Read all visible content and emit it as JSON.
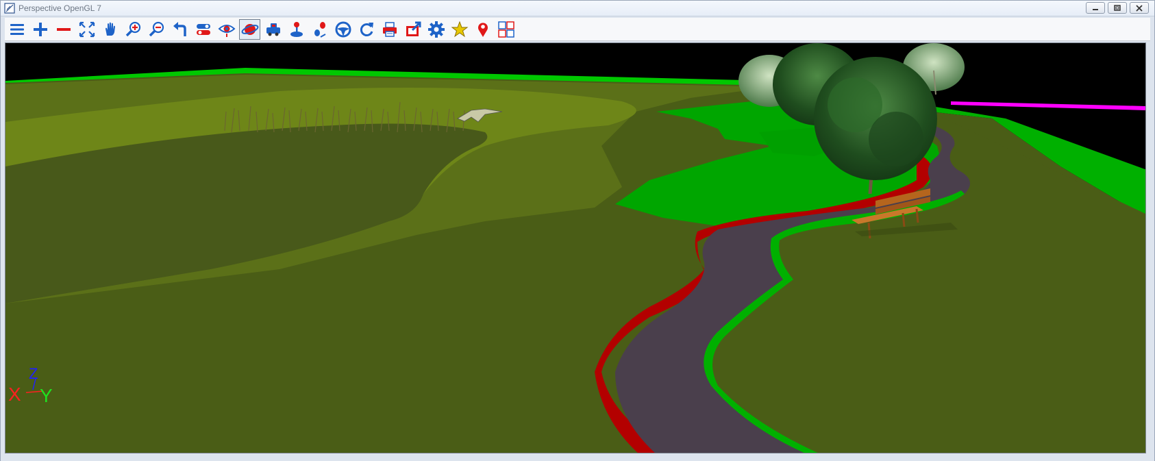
{
  "window": {
    "title": "Perspective OpenGL 7",
    "controls": [
      "minimize-icon",
      "restore-icon",
      "close-icon"
    ]
  },
  "toolbar": {
    "buttons": [
      {
        "name": "menu",
        "icon": "menu-icon",
        "selected": false
      },
      {
        "name": "zoom-in",
        "icon": "plus-icon",
        "selected": false
      },
      {
        "name": "zoom-out",
        "icon": "minus-icon",
        "selected": false
      },
      {
        "name": "fit-extents",
        "icon": "fit-arrows-icon",
        "selected": false
      },
      {
        "name": "pan",
        "icon": "hand-icon",
        "selected": false
      },
      {
        "name": "zoom-window",
        "icon": "magnifier-plus-icon",
        "selected": false
      },
      {
        "name": "zoom-previous",
        "icon": "magnifier-minus-icon",
        "selected": false
      },
      {
        "name": "undo-view",
        "icon": "undo-arrow-icon",
        "selected": false
      },
      {
        "name": "toggle-layers",
        "icon": "toggle-icon",
        "selected": false
      },
      {
        "name": "view-eye",
        "icon": "eye-icon",
        "selected": false
      },
      {
        "name": "orbit",
        "icon": "orbit-icon",
        "selected": true
      },
      {
        "name": "drive",
        "icon": "vehicle-icon",
        "selected": false
      },
      {
        "name": "joystick",
        "icon": "joystick-icon",
        "selected": false
      },
      {
        "name": "walk-path",
        "icon": "footsteps-icon",
        "selected": false
      },
      {
        "name": "steering",
        "icon": "steering-wheel-icon",
        "selected": false
      },
      {
        "name": "refresh",
        "icon": "refresh-icon",
        "selected": false
      },
      {
        "name": "print",
        "icon": "printer-icon",
        "selected": false
      },
      {
        "name": "export",
        "icon": "export-icon",
        "selected": false
      },
      {
        "name": "settings",
        "icon": "gear-icon",
        "selected": false
      },
      {
        "name": "favorites",
        "icon": "star-icon",
        "selected": false
      },
      {
        "name": "location",
        "icon": "map-pin-icon",
        "selected": false
      },
      {
        "name": "multi-view",
        "icon": "grid-icon",
        "selected": false
      }
    ]
  },
  "axis_indicator": {
    "x_label": "X",
    "y_label": "Y",
    "z_label": "Z"
  },
  "colors": {
    "sky": "#000000",
    "terrain_dark": "#4a5d16",
    "terrain_light": "#6f8818",
    "grass_bright": "#00a600",
    "path": "#4a3f4c",
    "path_edge_red": "#b30000",
    "magenta_line": "#ff00ff",
    "axis_x": "#ff2020",
    "axis_y": "#20e020",
    "axis_z": "#2020ff",
    "icon_blue": "#1e63c8",
    "icon_red": "#e01818"
  }
}
